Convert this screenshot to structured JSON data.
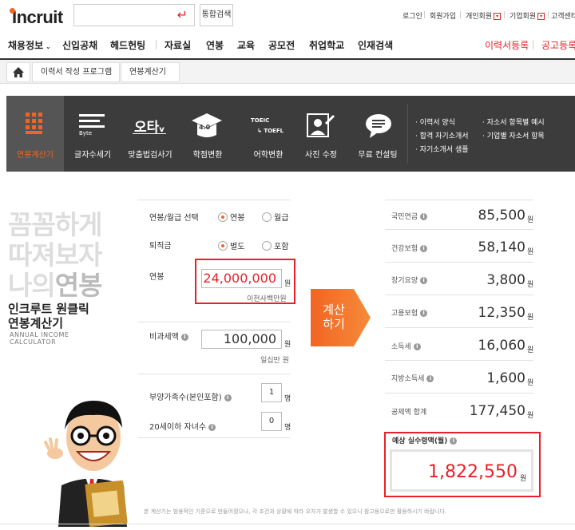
{
  "logo": "Incruit",
  "search": {
    "button": "통합검색"
  },
  "util": [
    "로그인",
    "회원가입",
    "개인회원",
    "기업회원",
    "고객센터"
  ],
  "gnb": [
    "채용정보",
    "신입공채",
    "헤드헌팅",
    "자료실",
    "연봉",
    "교육",
    "공모전",
    "취업학교",
    "인재검색"
  ],
  "gnb_right": [
    "이력서등록",
    "공고등록"
  ],
  "breadcrumb": [
    "이력서 작성 프로그램",
    "연봉계산기"
  ],
  "tools": [
    "연봉계산기",
    "글자수세기",
    "맞춤법검사기",
    "학점변환",
    "어학변환",
    "사진 수정",
    "무료 컨설팅"
  ],
  "tool_icons": {
    "byte": "Byte",
    "typo": "오타",
    "grade": "4.0",
    "toeic": "TOEIC",
    "toefl": "TOEFL"
  },
  "right_links": [
    "이력서 양식",
    "합격 자기소개서",
    "자기소개서 샘플",
    "자소서 항목별 예시",
    "기업별 자소서 항목"
  ],
  "left": {
    "line1": "꼼꼼하게",
    "line2": "따져보자",
    "line3a": "나의",
    "line3b": "연봉",
    "title1": "인크루트 원클릭",
    "title2": "연봉계산기",
    "sub1": "ANNUAL INCOME",
    "sub2": "CALCULATOR"
  },
  "form": {
    "type_label": "연봉/월급 선택",
    "type_opt1": "연봉",
    "type_opt2": "월급",
    "severance_label": "퇴직금",
    "sev_opt1": "별도",
    "sev_opt2": "포함",
    "salary_label": "연봉",
    "salary_value": "24,000,000",
    "salary_unit": "원",
    "salary_korean": "이천사백만원",
    "nontax_label": "비과세액",
    "nontax_value": "100,000",
    "nontax_unit": "원",
    "nontax_korean": "일십만 원",
    "dependents_label": "부양가족수(본인포함)",
    "dependents_value": "1",
    "dependents_unit": "명",
    "children_label": "20세이하 자녀수",
    "children_value": "0",
    "children_unit": "명"
  },
  "calc_button": {
    "line1": "계산",
    "line2": "하기"
  },
  "results": [
    {
      "label": "국민연금",
      "value": "85,500",
      "info": true
    },
    {
      "label": "건강보험",
      "value": "58,140",
      "info": true
    },
    {
      "label": "장기요양",
      "value": "3,800",
      "info": true
    },
    {
      "label": "고용보험",
      "value": "12,350",
      "info": true
    },
    {
      "label": "소득세",
      "value": "16,060",
      "info": true
    },
    {
      "label": "지방소득세",
      "value": "1,600",
      "info": true
    },
    {
      "label": "공제액 합계",
      "value": "177,450",
      "info": false
    }
  ],
  "won": "원",
  "net": {
    "label": "예상 실수령액(월)",
    "value": "1,822,550",
    "unit": "원"
  },
  "footer": "본 계산기는 범용적인 기준으로 만들어졌으나, 각 조건과 상황에 따라 오차가 발생할 수 있으니 참고용으로만 활용하시기 바랍니다.",
  "colors": {
    "accent": "#f26522",
    "highlight": "#e8202a",
    "dark": "#3c3c3c"
  }
}
